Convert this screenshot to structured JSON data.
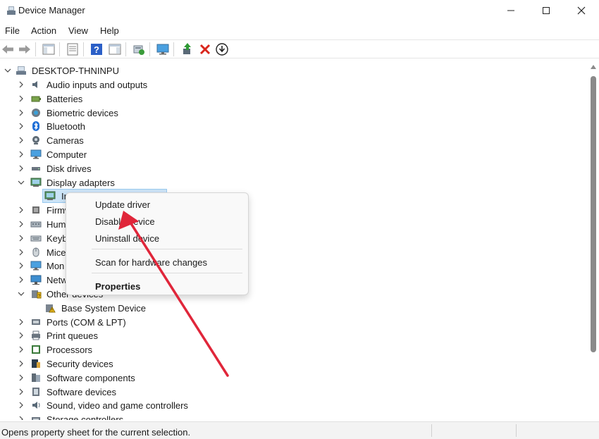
{
  "window": {
    "title": "Device Manager"
  },
  "menu": [
    "File",
    "Action",
    "View",
    "Help"
  ],
  "toolbar": {
    "buttons": [
      "back-icon",
      "forward-icon",
      "show-hide-console-tree-icon",
      "properties-icon",
      "help-icon",
      "action-pane-icon",
      "scan-hardware-icon",
      "monitor-icon",
      "update-driver-icon",
      "uninstall-icon",
      "download-icon"
    ]
  },
  "tree": {
    "root": "DESKTOP-THNINPU",
    "items": [
      {
        "label": "Audio inputs and outputs",
        "icon": "speaker-icon"
      },
      {
        "label": "Batteries",
        "icon": "battery-icon"
      },
      {
        "label": "Biometric devices",
        "icon": "biometric-icon"
      },
      {
        "label": "Bluetooth",
        "icon": "bluetooth-icon"
      },
      {
        "label": "Cameras",
        "icon": "camera-icon"
      },
      {
        "label": "Computer",
        "icon": "computer-icon"
      },
      {
        "label": "Disk drives",
        "icon": "disk-icon"
      },
      {
        "label": "Display adapters",
        "icon": "display-adapter-icon"
      },
      {
        "label": "In",
        "icon": "display-adapter-icon"
      },
      {
        "label": "Firmw",
        "icon": "firmware-icon"
      },
      {
        "label": "Hum",
        "icon": "hid-icon"
      },
      {
        "label": "Keyb",
        "icon": "keyboard-icon"
      },
      {
        "label": "Mice",
        "icon": "mouse-icon"
      },
      {
        "label": "Mon",
        "icon": "monitor-icon"
      },
      {
        "label": "Netw",
        "icon": "network-icon"
      },
      {
        "label": "Other devices",
        "icon": "other-devices-icon"
      },
      {
        "label": "Base System Device",
        "icon": "warning-device-icon"
      },
      {
        "label": "Ports (COM & LPT)",
        "icon": "port-icon"
      },
      {
        "label": "Print queues",
        "icon": "printer-icon"
      },
      {
        "label": "Processors",
        "icon": "processor-icon"
      },
      {
        "label": "Security devices",
        "icon": "security-icon"
      },
      {
        "label": "Software components",
        "icon": "software-component-icon"
      },
      {
        "label": "Software devices",
        "icon": "software-device-icon"
      },
      {
        "label": "Sound, video and game controllers",
        "icon": "sound-icon"
      },
      {
        "label": "Storage controllers",
        "icon": "storage-icon"
      }
    ]
  },
  "context_menu": {
    "update_driver": "Update driver",
    "disable_device": "Disable device",
    "uninstall_device": "Uninstall device",
    "scan": "Scan for hardware changes",
    "properties": "Properties"
  },
  "status": {
    "text": "Opens property sheet for the current selection."
  },
  "colors": {
    "accent_arrow": "#e0263a",
    "selection": "#cce4f7",
    "uninstall_red": "#d9261c"
  }
}
